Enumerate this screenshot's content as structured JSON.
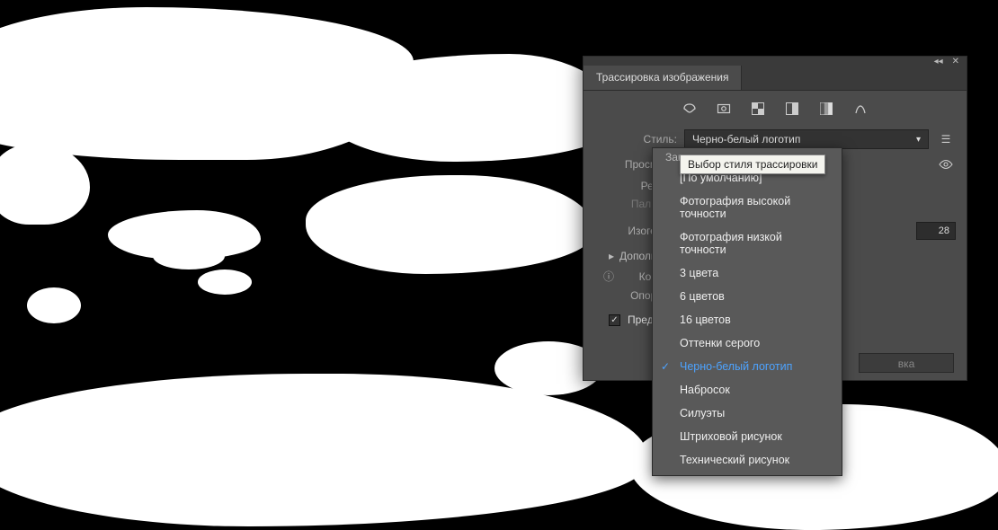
{
  "panel": {
    "tab_title": "Трассировка изображения",
    "presets": [
      "auto",
      "photo",
      "low",
      "3c",
      "bw",
      "outline"
    ],
    "style_label": "Стиль:",
    "style_value": "Черно-белый логотип",
    "view_label": "Просмотр:",
    "mode_label": "Режим:",
    "palette_label": "Палитра:",
    "threshold_label": "Изогелия:",
    "threshold_value": "28",
    "advanced_label": "Дополнительн",
    "paths_label": "Контуры:",
    "anchors_label": "Опорные т",
    "preview_label": "Предварител",
    "trace_button": "вка"
  },
  "tooltip": {
    "text": "Выбор стиля трассировки"
  },
  "dropdown": {
    "truncated_top": "Зак",
    "items": [
      "[По умолчанию]",
      "Фотография высокой точности",
      "Фотография низкой точности",
      "3 цвета",
      "6 цветов",
      "16 цветов",
      "Оттенки серого",
      "Черно-белый логотип",
      "Набросок",
      "Силуэты",
      "Штриховой рисунок",
      "Технический рисунок"
    ],
    "selected_index": 7
  }
}
